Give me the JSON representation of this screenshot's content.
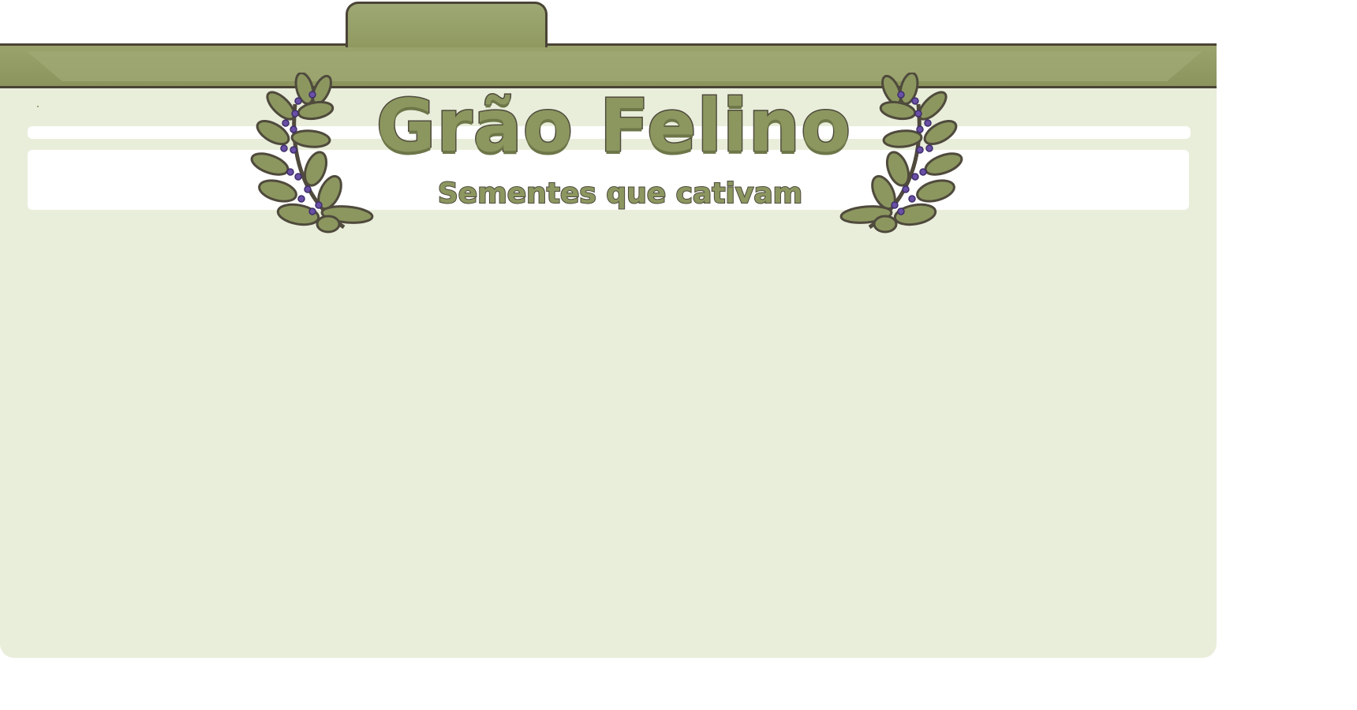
{
  "brand": {
    "title": "Grão Felino",
    "subtitle": "Sementes que cativam"
  },
  "colors": {
    "panel": "#e9eedb",
    "header": "#8f995f",
    "outline": "#4a4436",
    "berry": "#6a4fa6",
    "leaf": "#8c9760"
  },
  "icons": {
    "laurel_left": "laurel-wreath-icon",
    "laurel_right": "laurel-wreath-icon"
  }
}
